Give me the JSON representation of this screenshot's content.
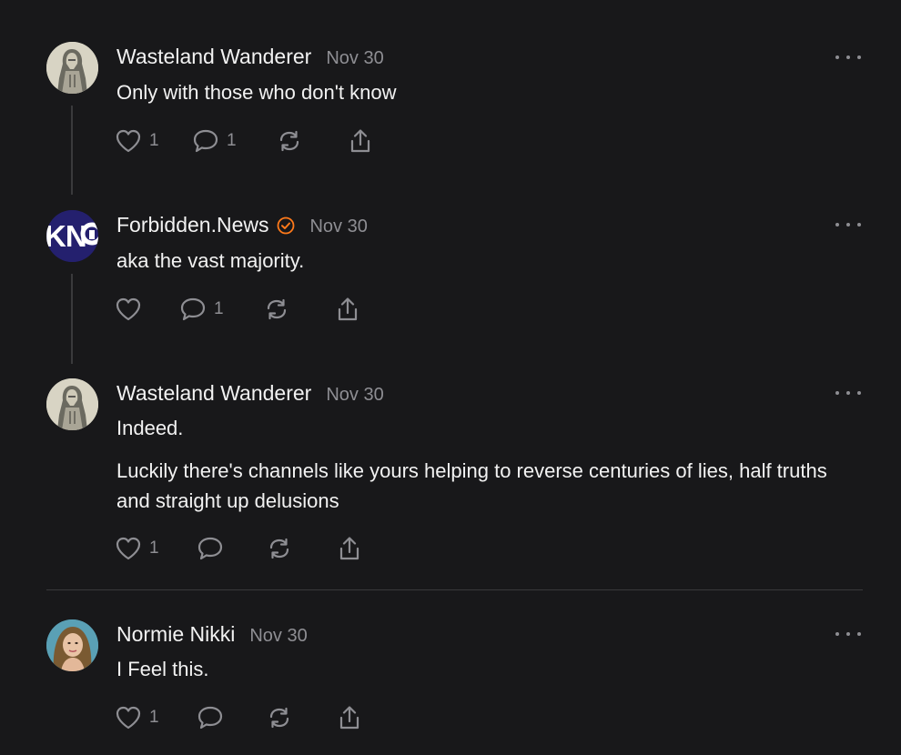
{
  "thread": {
    "posts": [
      {
        "author": "Wasteland Wanderer",
        "date": "Nov 30",
        "verified": false,
        "paragraphs": [
          "Only with those who don't know"
        ],
        "likes": "1",
        "comments": "1",
        "avatar_icon": "wanderer-avatar"
      },
      {
        "author": "Forbidden.News",
        "date": "Nov 30",
        "verified": true,
        "avatar_text": "KN",
        "paragraphs": [
          "aka the vast majority."
        ],
        "likes": "",
        "comments": "1",
        "avatar_icon": "forbidden-news-logo"
      },
      {
        "author": "Wasteland Wanderer",
        "date": "Nov 30",
        "verified": false,
        "paragraphs": [
          "Indeed.",
          "Luckily there's channels like yours helping to reverse centuries of lies, half truths and straight up delusions"
        ],
        "likes": "1",
        "comments": "",
        "avatar_icon": "wanderer-avatar"
      },
      {
        "author": "Normie Nikki",
        "date": "Nov 30",
        "verified": false,
        "paragraphs": [
          "I Feel this."
        ],
        "likes": "1",
        "comments": "",
        "avatar_icon": "nikki-avatar"
      }
    ]
  },
  "colors": {
    "background": "#18181a",
    "text": "#f2f2f2",
    "muted": "#8e8e93",
    "verified": "#ff7a1a",
    "thread_line": "#3a3a3c"
  }
}
